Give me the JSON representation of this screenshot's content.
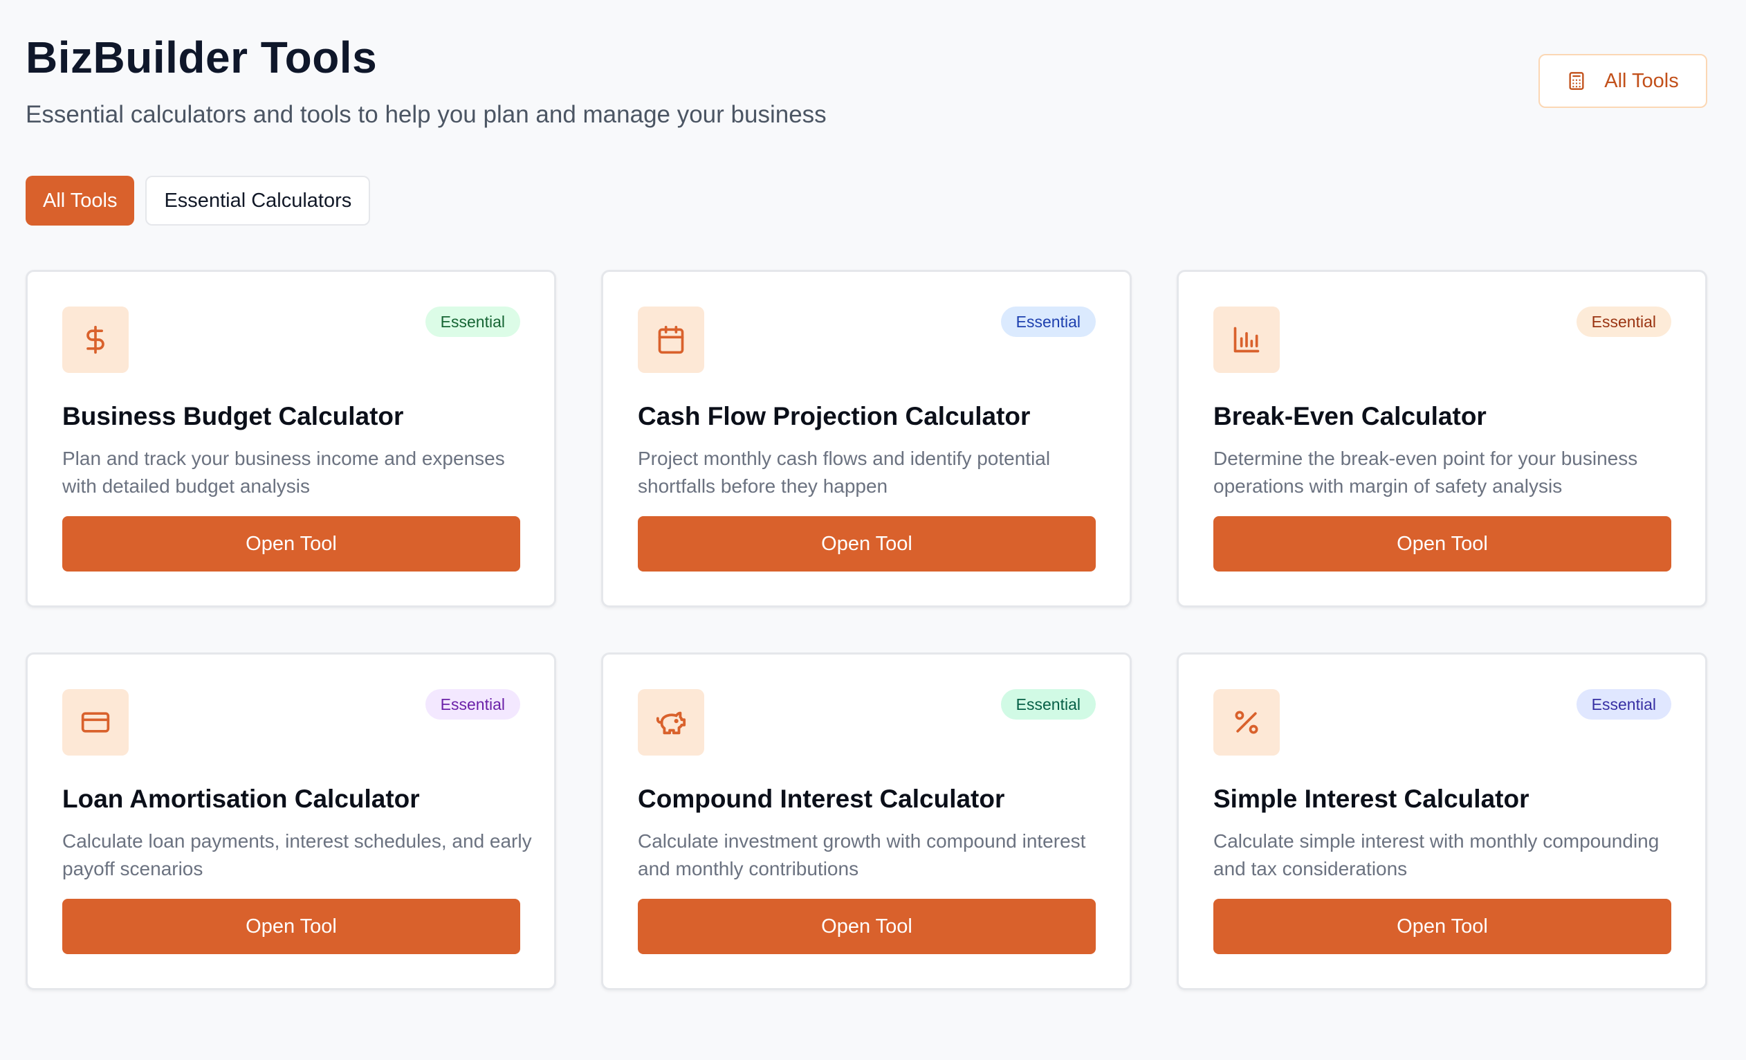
{
  "header": {
    "title": "BizBuilder Tools",
    "subtitle": "Essential calculators and tools to help you plan and manage your business",
    "all_tools_label": "All Tools"
  },
  "filters": [
    {
      "label": "All Tools",
      "active": true
    },
    {
      "label": "Essential Calculators",
      "active": false
    }
  ],
  "cards": [
    {
      "title": "Business Budget Calculator",
      "description": "Plan and track your business income and expenses with detailed budget analysis",
      "badge": "Essential",
      "badge_colors": {
        "bg": "#dcfce7",
        "fg": "#166534"
      },
      "icon": "dollar-icon",
      "button": "Open Tool"
    },
    {
      "title": "Cash Flow Projection Calculator",
      "description": "Project monthly cash flows and identify potential shortfalls before they happen",
      "badge": "Essential",
      "badge_colors": {
        "bg": "#dbeafe",
        "fg": "#1e40af"
      },
      "icon": "calendar-icon",
      "button": "Open Tool"
    },
    {
      "title": "Break-Even Calculator",
      "description": "Determine the break-even point for your business operations with margin of safety analysis",
      "badge": "Essential",
      "badge_colors": {
        "bg": "#fdebd8",
        "fg": "#9a3412"
      },
      "icon": "bar-chart-icon",
      "button": "Open Tool"
    },
    {
      "title": "Loan Amortisation Calculator",
      "description": "Calculate loan payments, interest schedules, and early payoff scenarios",
      "badge": "Essential",
      "badge_colors": {
        "bg": "#f3e8ff",
        "fg": "#6b21a8"
      },
      "icon": "credit-card-icon",
      "button": "Open Tool"
    },
    {
      "title": "Compound Interest Calculator",
      "description": "Calculate investment growth with compound interest and monthly contributions",
      "badge": "Essential",
      "badge_colors": {
        "bg": "#d1fae5",
        "fg": "#065f46"
      },
      "icon": "piggy-bank-icon",
      "button": "Open Tool"
    },
    {
      "title": "Simple Interest Calculator",
      "description": "Calculate simple interest with monthly compounding and tax considerations",
      "badge": "Essential",
      "badge_colors": {
        "bg": "#e0e7ff",
        "fg": "#3730a3"
      },
      "icon": "percent-icon",
      "button": "Open Tool"
    }
  ],
  "colors": {
    "accent": "#d9612c",
    "icon_bg": "#fde8d6",
    "page_bg": "#f8f9fb"
  }
}
